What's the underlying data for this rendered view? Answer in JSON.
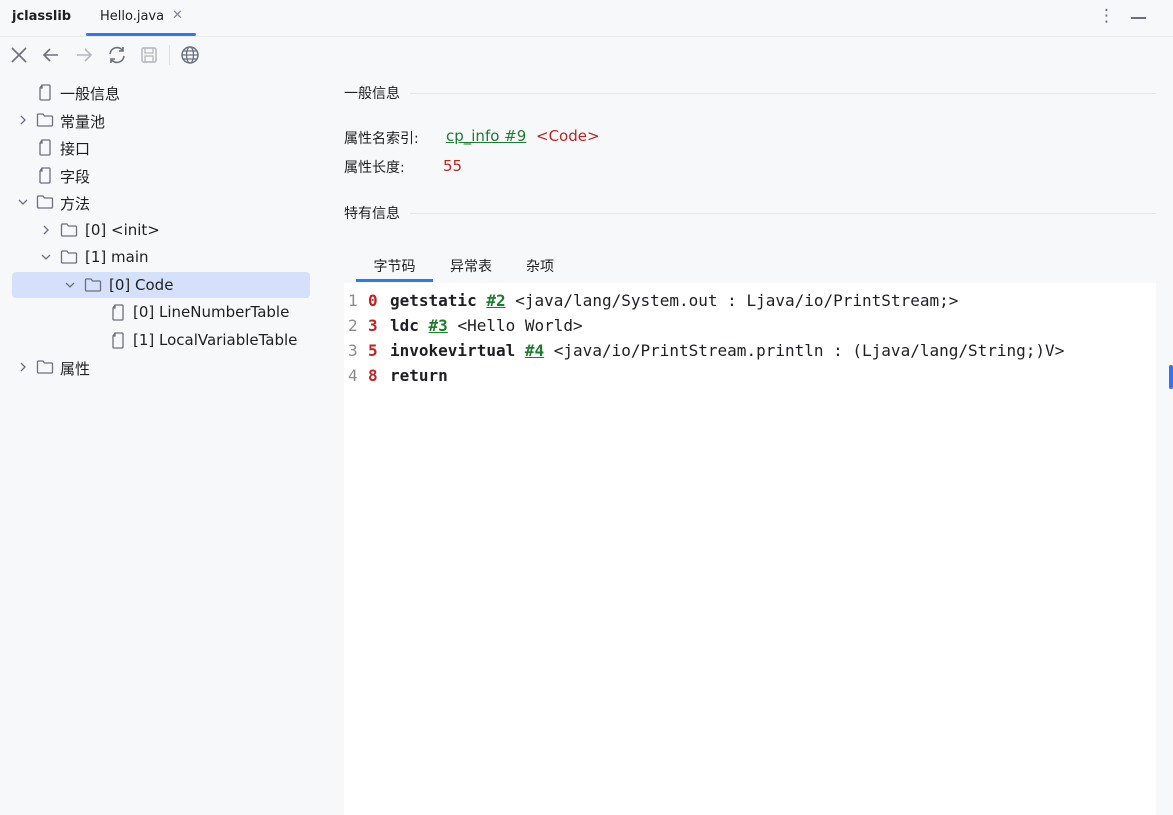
{
  "app": {
    "title": "jclasslib",
    "file_tab": "Hello.java",
    "close_glyph": "✕",
    "more_glyph": "⋮"
  },
  "toolbar": {
    "buttons": [
      "close-icon",
      "back-icon",
      "forward-icon",
      "refresh-icon",
      "save-icon",
      "web-icon"
    ]
  },
  "tree": {
    "items": [
      {
        "label": "一般信息",
        "icon": "file-icon"
      },
      {
        "label": "常量池",
        "icon": "folder-icon",
        "expander": "collapsed"
      },
      {
        "label": "接口",
        "icon": "file-icon"
      },
      {
        "label": "字段",
        "icon": "file-icon"
      },
      {
        "label": "方法",
        "icon": "folder-icon",
        "expander": "expanded"
      },
      {
        "label": "[0] <init>",
        "icon": "folder-icon",
        "expander": "collapsed"
      },
      {
        "label": "[1] main",
        "icon": "folder-icon",
        "expander": "expanded"
      },
      {
        "label": "[0] Code",
        "icon": "folder-icon",
        "expander": "expanded",
        "selected": true
      },
      {
        "label": "[0] LineNumberTable",
        "icon": "file-icon"
      },
      {
        "label": "[1] LocalVariableTable",
        "icon": "file-icon"
      },
      {
        "label": "属性",
        "icon": "folder-icon",
        "expander": "collapsed"
      }
    ]
  },
  "general": {
    "section_title": "一般信息",
    "attr_name_label": "属性名索引:",
    "attr_name_link": "cp_info #9",
    "attr_name_value": "<Code>",
    "attr_length_label": "属性长度:",
    "attr_length_value": "55"
  },
  "specific": {
    "section_title": "特有信息",
    "tabs": [
      "字节码",
      "异常表",
      "杂项"
    ],
    "active_tab": "字节码"
  },
  "bytecode": {
    "lines": [
      {
        "line": "1",
        "offset": "0",
        "op": "getstatic",
        "ref": "#2",
        "comment": "<java/lang/System.out : Ljava/io/PrintStream;>"
      },
      {
        "line": "2",
        "offset": "3",
        "op": "ldc",
        "ref": "#3",
        "comment": "<Hello World>"
      },
      {
        "line": "3",
        "offset": "5",
        "op": "invokevirtual",
        "ref": "#4",
        "comment": "<java/io/PrintStream.println : (Ljava/lang/String;)V>"
      },
      {
        "line": "4",
        "offset": "8",
        "op": "return",
        "ref": "",
        "comment": ""
      }
    ]
  },
  "colors": {
    "accent": "#3574f0",
    "link_green": "#1c7d2d",
    "value_red": "#c0241f",
    "selection": "#d5e1fb"
  }
}
